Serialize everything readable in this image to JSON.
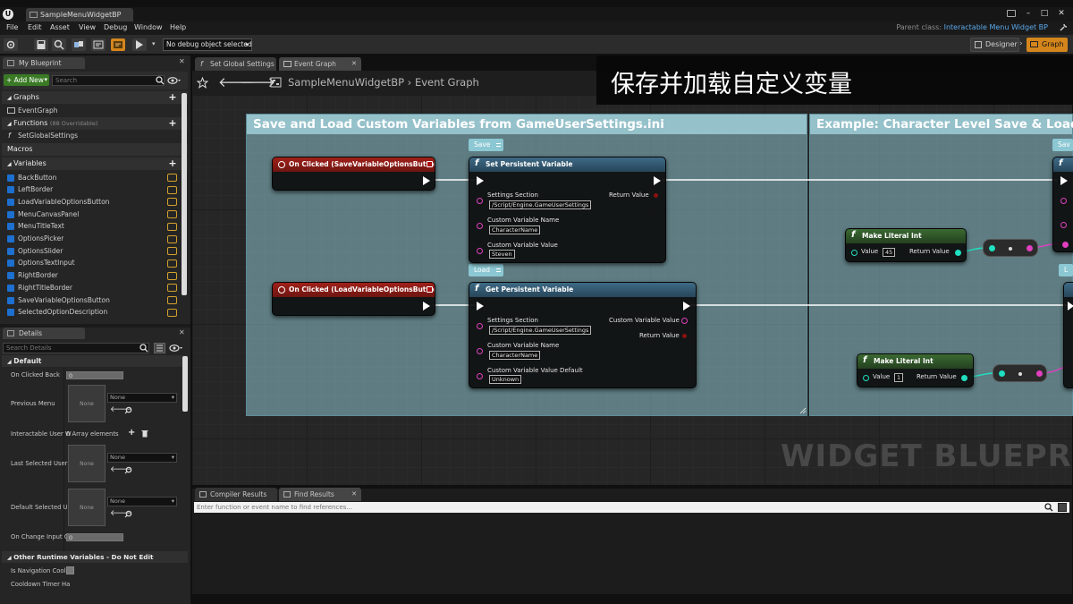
{
  "window": {
    "tab_title": "SampleMenuWidgetBP",
    "logo": "U",
    "controls": [
      "–",
      "□",
      "✕"
    ]
  },
  "menu": [
    "File",
    "Edit",
    "Asset",
    "View",
    "Debug",
    "Window",
    "Help"
  ],
  "parent_class": {
    "label": "Parent class:",
    "value": "Interactable Menu Widget BP"
  },
  "toolbar": {
    "debug_object": "No debug object selected",
    "designer": "Designer",
    "graph": "Graph",
    "accent": "#d4861c"
  },
  "my_blueprint": {
    "tab": "My Blueprint",
    "add_new": "+ Add New",
    "search_placeholder": "Search",
    "graphs_label": "Graphs",
    "event_graph": "EventGraph",
    "functions_label": "Functions",
    "functions_note": "(88 Overridable)",
    "function_item": "SetGlobalSettings",
    "macros_label": "Macros",
    "variables_label": "Variables",
    "variables": [
      "BackButton",
      "LeftBorder",
      "LoadVariableOptionsButton",
      "MenuCanvasPanel",
      "MenuTitleText",
      "OptionsPicker",
      "OptionsSlider",
      "OptionsTextInput",
      "RightBorder",
      "RightTitleBorder",
      "SaveVariableOptionsButton",
      "SelectedOptionDescription"
    ]
  },
  "details": {
    "tab": "Details",
    "search_placeholder": "Search Details",
    "section_default": "Default",
    "on_clicked_back": "On Clicked Back",
    "on_clicked_back_value": "0",
    "previous_menu": "Previous Menu",
    "thumb_none": "None",
    "dropdown_none": "None",
    "interactable_user": "Interactable User W",
    "array_elements": "0 Array elements",
    "last_selected_user": "Last Selected User",
    "default_selected": "Default Selected U",
    "on_change_input": "On Change Input Or",
    "on_change_input_value": "0",
    "section_other": "Other Runtime Variables - Do Not Edit",
    "is_navigation": "Is Navigation Coolo",
    "cooldown_timer": "Cooldown Timer Ha"
  },
  "content_tabs": [
    "Set Global Settings",
    "Event Graph"
  ],
  "breadcrumb": {
    "root": "SampleMenuWidgetBP",
    "separator": "›",
    "current": "Event Graph"
  },
  "banner_text": "保存并加载自定义变量",
  "comments": {
    "left_title": "Save and Load Custom Variables from GameUserSettings.ini",
    "right_title": "Example: Character Level Save & Load",
    "tag_save": "Save",
    "tag_load": "Load",
    "tag_save_partial": "Sav",
    "tag_load_partial": "L"
  },
  "nodes": {
    "event_save": "On Clicked (SaveVariableOptionsButton)",
    "event_load": "On Clicked (LoadVariableOptionsButton)",
    "set_var": {
      "title": "Set Persistent Variable",
      "settings_section": "Settings Section",
      "settings_value": "/Script/Engine.GameUserSettings",
      "custom_name": "Custom Variable Name",
      "custom_name_value": "CharacterName",
      "custom_value": "Custom Variable Value",
      "custom_value_value": "Steven",
      "return_value": "Return Value"
    },
    "get_var": {
      "title": "Get Persistent Variable",
      "settings_section": "Settings Section",
      "settings_value": "/Script/Engine.GameUserSettings",
      "custom_name": "Custom Variable Name",
      "custom_name_value": "CharacterName",
      "custom_default": "Custom Variable Value Default",
      "custom_default_value": "Unknown",
      "out_custom_value": "Custom Variable Value",
      "return_value": "Return Value"
    },
    "literal_1": {
      "title": "Make Literal Int",
      "value_label": "Value",
      "value": "45",
      "return_value": "Return Value"
    },
    "literal_2": {
      "title": "Make Literal Int",
      "value_label": "Value",
      "value": "1",
      "return_value": "Return Value"
    }
  },
  "watermark": "WIDGET BLUEPRINT",
  "bottom": {
    "tabs": [
      "Compiler Results",
      "Find Results"
    ],
    "find_placeholder": "Enter function or event name to find references..."
  },
  "colors": {
    "exec_wire": "#ffffff",
    "string_pin": "#e040c0",
    "int_pin": "#1fe0c0",
    "bool_pin": "#8b1111",
    "event_header": "#a0201a",
    "function_header": "#3e6a85",
    "comment": "#96d2de"
  }
}
